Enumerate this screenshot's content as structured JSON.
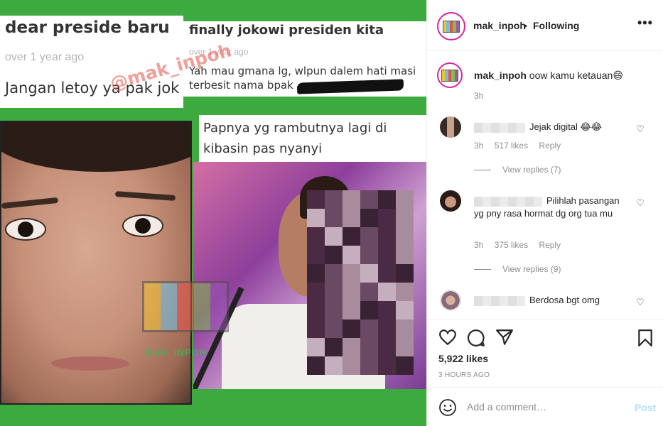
{
  "post_image": {
    "card1": {
      "title": "dear preside baru",
      "time": "over 1 year ago",
      "body": "Jangan letoy ya pak jok"
    },
    "card2": {
      "title": "finally jokowi presiden kita",
      "time": "over 1 year ago",
      "body": "Yah mau gmana lg, wlpun dalem hati masi terbesit nama bpak"
    },
    "card3": {
      "title": "Papnya yg rambutnya lagi di kibasin pas nyanyi"
    },
    "watermark": "@mak_inpoh",
    "logo_watermark": "MAK_INPOH",
    "colors": {
      "background": "#3daa3f"
    }
  },
  "header": {
    "username": "mak_inpoh",
    "separator": "•",
    "follow_status": "Following",
    "more_icon": "more-horizontal-icon"
  },
  "caption": {
    "username": "mak_inpoh",
    "text": "oow kamu ketauan😄",
    "time": "3h"
  },
  "comments": [
    {
      "text": "Jejak digital 😂😂",
      "time": "3h",
      "likes": "517 likes",
      "reply": "Reply",
      "view_replies": "View replies (7)"
    },
    {
      "text": "Pilihlah pasangan yg pny rasa hormat dg org tua mu",
      "time": "3h",
      "likes": "375 likes",
      "reply": "Reply",
      "view_replies": "View replies (9)"
    },
    {
      "text": "Berdosa bgt omg"
    }
  ],
  "actions": {
    "likes": "5,922 likes",
    "time_ago": "3 HOURS AGO"
  },
  "add_comment": {
    "placeholder": "Add a comment…",
    "post_label": "Post"
  },
  "colors": {
    "link_blue_disabled": "#b2dffc",
    "secondary_text": "#8e8e8e",
    "primary_text": "#262626",
    "story_ring": "#d6249f"
  }
}
